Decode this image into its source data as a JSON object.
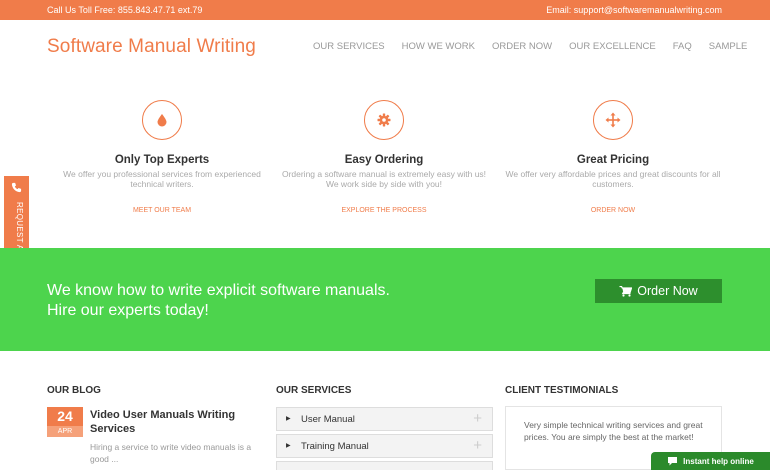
{
  "topbar": {
    "phone": "Call Us Toll Free: 855.843.47.71 ext.79",
    "email": "Email: support@softwaremanualwriting.com"
  },
  "header": {
    "logo": "Software Manual Writing",
    "nav": [
      "OUR SERVICES",
      "HOW WE WORK",
      "ORDER NOW",
      "OUR EXCELLENCE",
      "FAQ",
      "SAMPLE"
    ]
  },
  "features": [
    {
      "icon": "drop-icon",
      "title": "Only Top Experts",
      "desc": "We offer you professional services from experienced technical writers.",
      "link": "MEET OUR TEAM"
    },
    {
      "icon": "gear-icon",
      "title": "Easy Ordering",
      "desc": "Ordering a software manual is extremely easy with us! We work side by side with you!",
      "link": "EXPLORE THE PROCESS"
    },
    {
      "icon": "move-arrows-icon",
      "title": "Great Pricing",
      "desc": "We offer very affordable prices and great discounts for all customers.",
      "link": "ORDER NOW"
    }
  ],
  "callback": {
    "label": "REQUEST A CALLBACK"
  },
  "banner": {
    "line1": "We know how to write explicit software manuals.",
    "line2": "Hire our experts today!",
    "button": "Order Now"
  },
  "blog": {
    "heading": "OUR BLOG",
    "day": "24",
    "month": "APR",
    "title": "Video User Manuals Writing Services",
    "excerpt": "Hiring a service to write video manuals is a good ..."
  },
  "services": {
    "heading": "OUR SERVICES",
    "items": [
      "User Manual",
      "Training Manual"
    ]
  },
  "testimonials": {
    "heading": "CLIENT TESTIMONIALS",
    "quote": "Very simple technical writing services and great prices. You are simply the best at the market!"
  },
  "help": {
    "label": "Instant help online"
  },
  "colors": {
    "accent": "#f07c4a",
    "banner": "#4dd44d",
    "button_dark": "#2d8f2d"
  }
}
